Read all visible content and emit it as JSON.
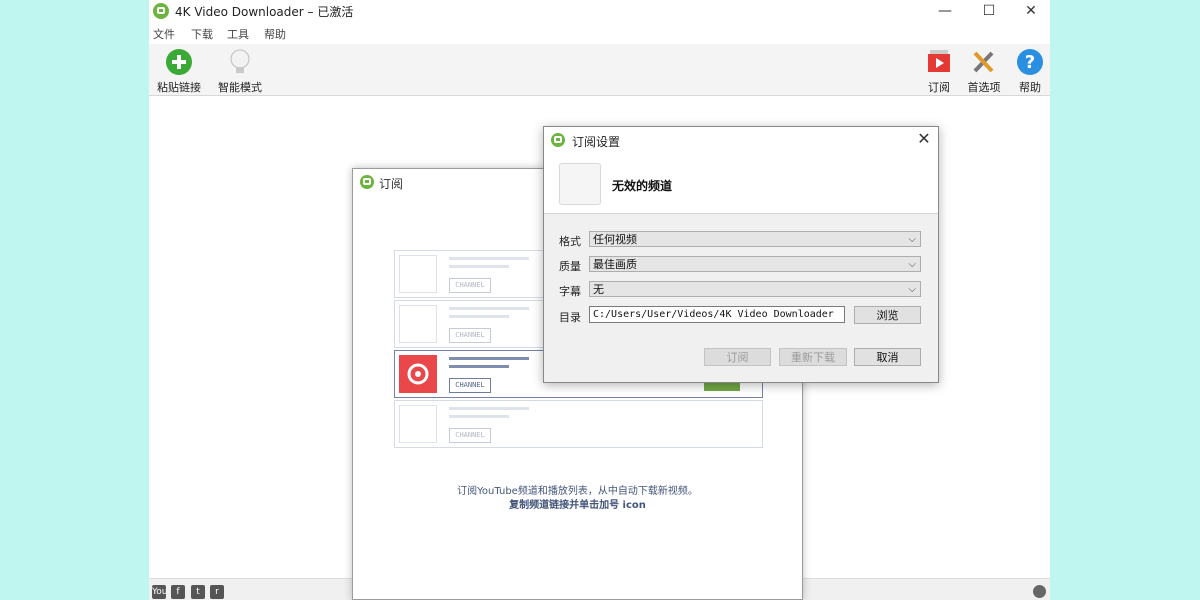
{
  "window": {
    "title": "4K Video Downloader – 已激活",
    "controls": {
      "minimize": "—",
      "maximize": "☐",
      "close": "✕"
    }
  },
  "menu": [
    "文件",
    "下载",
    "工具",
    "帮助"
  ],
  "toolbar": {
    "paste_link": "粘贴链接",
    "smart_mode": "智能模式",
    "subscriptions": "订阅",
    "preferences": "首选项",
    "help": "帮助"
  },
  "subscriptions_dialog": {
    "title": "订阅",
    "card_tag": "CHANNEL",
    "hint_line1": "订阅YouTube频道和播放列表，从中自动下载新视频。",
    "hint_line2": "复制频道链接并单击加号 icon"
  },
  "settings_dialog": {
    "title": "订阅设置",
    "close": "✕",
    "channel_name": "无效的频道",
    "format_label": "格式",
    "format_value": "任何视频",
    "quality_label": "质量",
    "quality_value": "最佳画质",
    "subtitles_label": "字幕",
    "subtitles_value": "无",
    "directory_label": "目录",
    "directory_value": "C:/Users/User/Videos/4K Video Downloader",
    "browse_button": "浏览",
    "subscribe_button": "订阅",
    "redownload_button": "重新下载",
    "cancel_button": "取消"
  },
  "statusbar": {
    "youtube": "You",
    "facebook": "f",
    "twitter": "t",
    "reddit": "r"
  },
  "colors": {
    "accent_green": "#6db33f",
    "card_red": "#e9474a",
    "background": "#bff7f0"
  }
}
